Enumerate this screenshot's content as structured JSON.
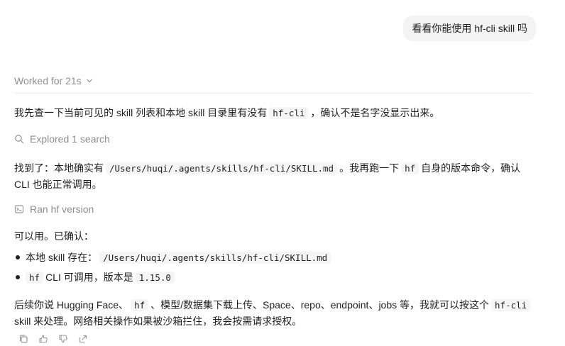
{
  "user_message": "看看你能使用 hf-cli skill 吗",
  "worked": {
    "label": "Worked for 21s"
  },
  "p1": {
    "before": "我先查一下当前可见的 skill 列表和本地 skill 目录里有没有",
    "code": "hf-cli",
    "after": "，确认不是名字没显示出来。"
  },
  "activity1": {
    "label": "Explored 1 search",
    "icon": "search-icon"
  },
  "p2": {
    "before": "找到了：本地确实有",
    "code1": "/Users/huqi/.agents/skills/hf-cli/SKILL.md",
    "mid": "。我再跑一下",
    "code2": "hf",
    "after_line1": "自身的版本命令，确认",
    "line2": "CLI 也能正常调用。"
  },
  "activity2": {
    "label": "Ran hf version",
    "icon": "terminal-icon"
  },
  "p3": {
    "text": "可以用。已确认："
  },
  "bullets": [
    {
      "before": "本地 skill 存在：",
      "code": "/Users/huqi/.agents/skills/hf-cli/SKILL.md"
    },
    {
      "code1": "hf",
      "mid": "CLI 可调用，版本是",
      "code2": "1.15.0"
    }
  ],
  "p4": {
    "t1": "后续你说 Hugging Face、",
    "code1": "hf",
    "t2": "、模型/数据集下载上传、Space、repo、endpoint、jobs 等，我就可以按这个",
    "code2": "hf-cli",
    "line2": "skill 来处理。网络相关操作如果被沙箱拦住，我会按需请求授权。"
  },
  "actions": [
    {
      "icon": "copy-icon"
    },
    {
      "icon": "thumbs-up-icon"
    },
    {
      "icon": "thumbs-down-icon"
    },
    {
      "icon": "share-icon"
    }
  ]
}
